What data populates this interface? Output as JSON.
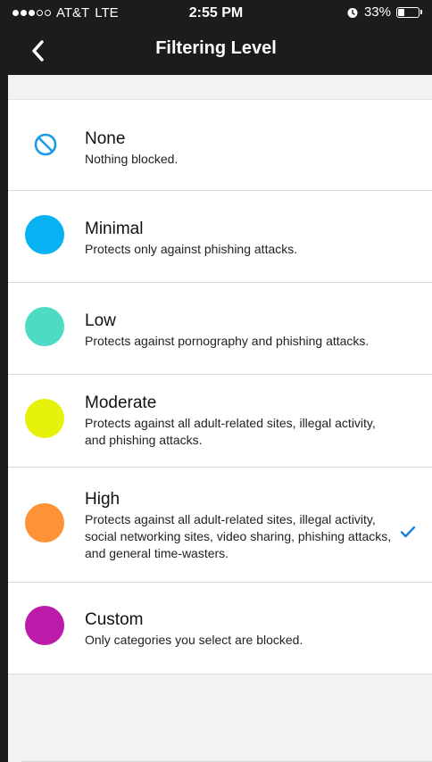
{
  "status_bar": {
    "carrier": "AT&T",
    "network": "LTE",
    "time": "2:55 PM",
    "battery": "33%",
    "battery_level": 0.33,
    "signal_bars_filled": 3,
    "signal_bars_total": 5
  },
  "nav": {
    "title": "Filtering Level",
    "back_icon": "chevron-left-icon"
  },
  "levels": [
    {
      "title": "None",
      "description": "Nothing blocked.",
      "color": "#1a9be6",
      "icon": "no-entry-icon",
      "selected": false
    },
    {
      "title": "Minimal",
      "description": "Protects only against phishing attacks.",
      "color": "#07b1f2",
      "icon": "circle-icon",
      "selected": false
    },
    {
      "title": "Low",
      "description": "Protects against pornography and phishing attacks.",
      "color": "#4ddbc4",
      "icon": "circle-icon",
      "selected": false
    },
    {
      "title": "Moderate",
      "description": "Protects against all adult-related sites, illegal activity, and phishing attacks.",
      "color": "#e6f20b",
      "icon": "circle-icon",
      "selected": false
    },
    {
      "title": "High",
      "description": "Protects against all adult-related sites, illegal activity, social networking sites, video sharing, phishing attacks, and general time-wasters.",
      "color": "#fd9236",
      "icon": "circle-icon",
      "selected": true
    },
    {
      "title": "Custom",
      "description": "Only categories you select are blocked.",
      "color": "#bc1ba9",
      "icon": "circle-icon",
      "selected": false
    }
  ],
  "colors": {
    "header_background": "#1c1c1c",
    "page_background": "#f2f2f2",
    "check_color": "#1a7fe0"
  }
}
